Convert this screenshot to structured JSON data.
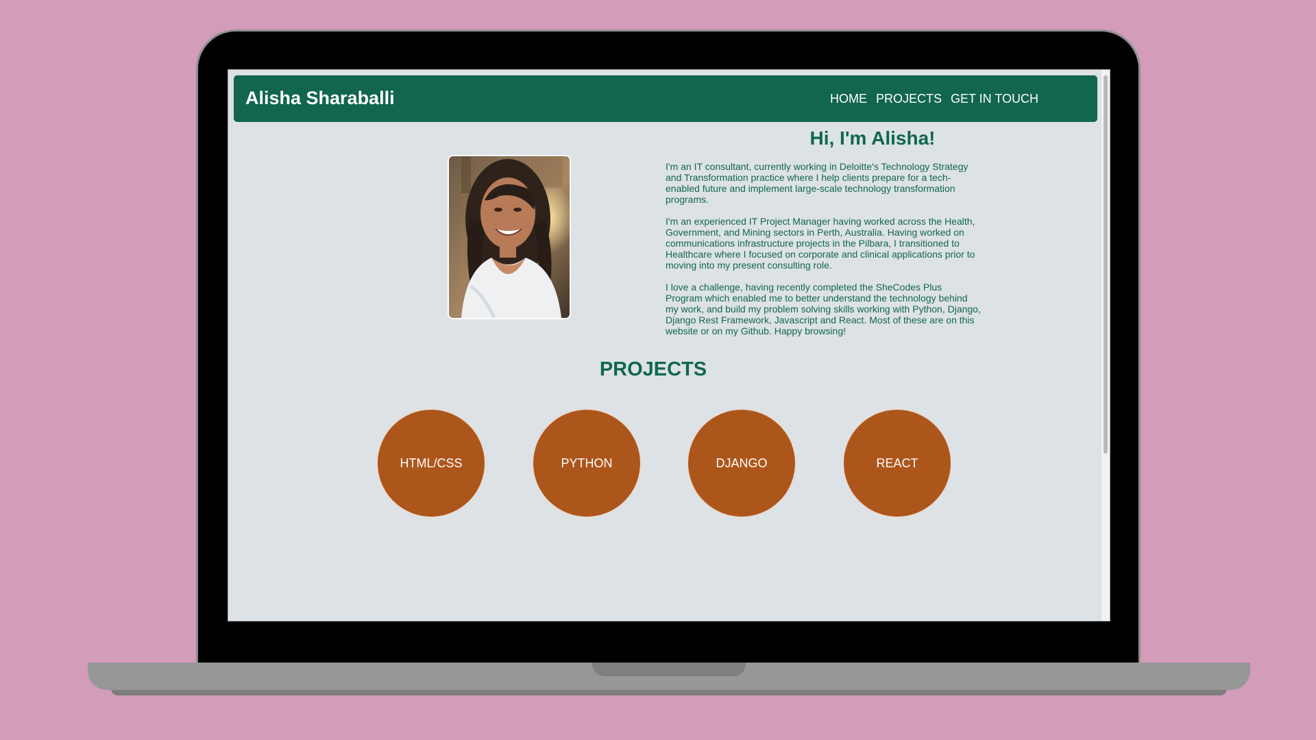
{
  "site": {
    "brand": "Alisha Sharaballi",
    "nav": [
      "HOME",
      "PROJECTS",
      "GET IN TOUCH"
    ]
  },
  "about": {
    "greeting": "Hi, I'm Alisha!",
    "paragraphs": [
      "I'm an IT consultant, currently working in Deloitte's Technology Strategy and Transformation practice where I help clients prepare for a tech-enabled future and implement large-scale technology transformation programs.",
      "I'm an experienced IT Project Manager having worked across the Health, Government, and Mining sectors in Perth, Australia. Having worked on communications infrastructure projects in the Pilbara, I transitioned to Healthcare where I focused on corporate and clinical applications prior to moving into my present consulting role.",
      "I love a challenge, having recently completed the SheCodes Plus Program which enabled me to better understand the technology behind my work, and build my problem solving skills working with Python, Django, Django Rest Framework, Javascript and React. Most of these are on this website or on my Github. Happy browsing!"
    ]
  },
  "projects": {
    "title": "PROJECTS",
    "items": [
      "HTML/CSS",
      "PYTHON",
      "DJANGO",
      "REACT"
    ]
  },
  "colors": {
    "page_background": "#d39cb9",
    "navbar": "#11664d",
    "accent_text": "#11664d",
    "project_circle": "#ad561c",
    "screen_background": "#dde2e6"
  },
  "icons": {
    "photo": "portrait-photo"
  }
}
